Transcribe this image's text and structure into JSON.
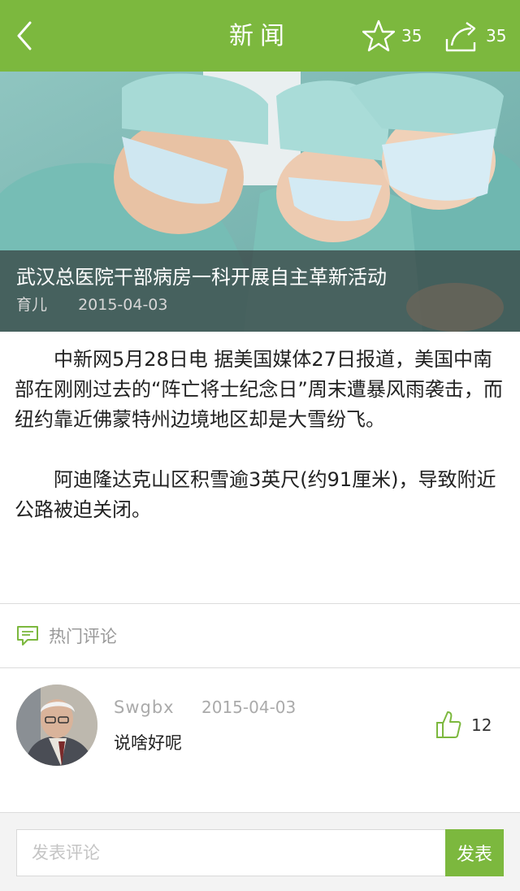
{
  "header": {
    "title": "新闻",
    "favorite_count": "35",
    "share_count": "35"
  },
  "hero": {
    "headline": "武汉总医院干部病房一科开展自主革新活动",
    "category": "育儿",
    "date": "2015-04-03"
  },
  "article": {
    "paragraphs": [
      "中新网5月28日电 据美国媒体27日报道，美国中南部在刚刚过去的“阵亡将士纪念日”周末遭暴风雨袭击，而纽约靠近佛蒙特州边境地区却是大雪纷飞。",
      "阿迪隆达克山区积雪逾3英尺(约91厘米)，导致附近公路被迫关闭。"
    ]
  },
  "hot_comments": {
    "label": "热门评论"
  },
  "comments": [
    {
      "user": "Swgbx",
      "date": "2015-04-03",
      "text": "说啥好呢",
      "likes": "12"
    }
  ],
  "composer": {
    "placeholder": "发表评论",
    "send_label": "发表"
  },
  "colors": {
    "accent": "#7cb83e"
  }
}
